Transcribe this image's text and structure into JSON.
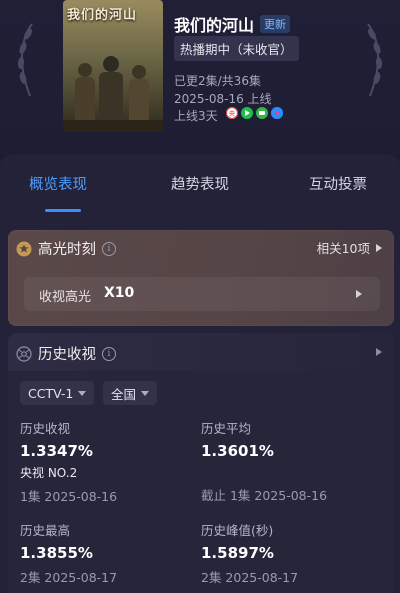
{
  "header": {
    "poster_title": "我们的河山",
    "show_title": "我们的河山",
    "update_badge": "更新",
    "status": "热播期中（未收官）",
    "episodes": "已更2集/共36集",
    "release": "2025-08-16 上线",
    "days_online": "上线3天",
    "platforms": [
      {
        "icon": "cctv-icon",
        "color": "#e23b3b"
      },
      {
        "icon": "iqiyi-play-icon",
        "color": "#1fbf4a"
      },
      {
        "icon": "wechat-video-icon",
        "color": "#39b54a"
      },
      {
        "icon": "youku-icon",
        "color": "#2a8cff"
      }
    ]
  },
  "tabs": [
    {
      "label": "概览表现",
      "active": true
    },
    {
      "label": "趋势表现",
      "active": false
    },
    {
      "label": "互动投票",
      "active": false
    }
  ],
  "highlight": {
    "title": "高光时刻",
    "related": "相关10项",
    "row_label": "收视高光",
    "row_value": "X10"
  },
  "history": {
    "title": "历史收视",
    "channel": "CCTV-1",
    "region": "全国",
    "stats": [
      {
        "label": "历史收视",
        "value": "1.3347%",
        "extra": "央视 NO.2",
        "sub": "1集 2025-08-16"
      },
      {
        "label": "历史平均",
        "value": "1.3601%",
        "sub": "截止 1集 2025-08-16"
      },
      {
        "label": "历史最高",
        "value": "1.3855%",
        "sub": "2集 2025-08-17"
      },
      {
        "label": "历史峰值(秒)",
        "value": "1.5897%",
        "sub": "2集 2025-08-17"
      }
    ]
  },
  "colors": {
    "accent": "#3f8cff",
    "bg": "#1b1a2e",
    "highlight_card": "#574647"
  }
}
